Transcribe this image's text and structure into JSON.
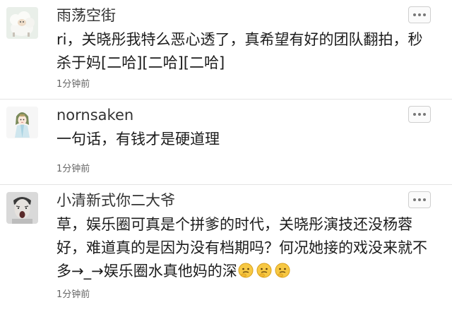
{
  "comments": [
    {
      "username": "雨荡空街",
      "text": "ri，关晓彤我特么恶心透了，真希望有好的团队翻拍，秒杀于妈[二哈][二哈][二哈]",
      "time": "1分钟前",
      "avatar_icon": "sheep-avatar",
      "more_icon": "more-dots-icon"
    },
    {
      "username": "nornsaken",
      "text": "一句话，有钱才是硬道理",
      "time": "1分钟前",
      "avatar_icon": "anime-girl-avatar",
      "more_icon": "more-dots-icon"
    },
    {
      "username": "小清新式你二大爷",
      "text": "草，娱乐圈可真是个拼爹的时代，关晓彤演技还没杨蓉好，难道真的是因为没有档期吗？何况她接的戏没来就不多→_→娱乐圈水真他妈的深",
      "time": "1分钟前",
      "avatar_icon": "man-shouting-avatar",
      "more_icon": "more-dots-icon",
      "emojis": [
        "thinking-emoji",
        "thinking-emoji",
        "thinking-emoji"
      ]
    }
  ]
}
